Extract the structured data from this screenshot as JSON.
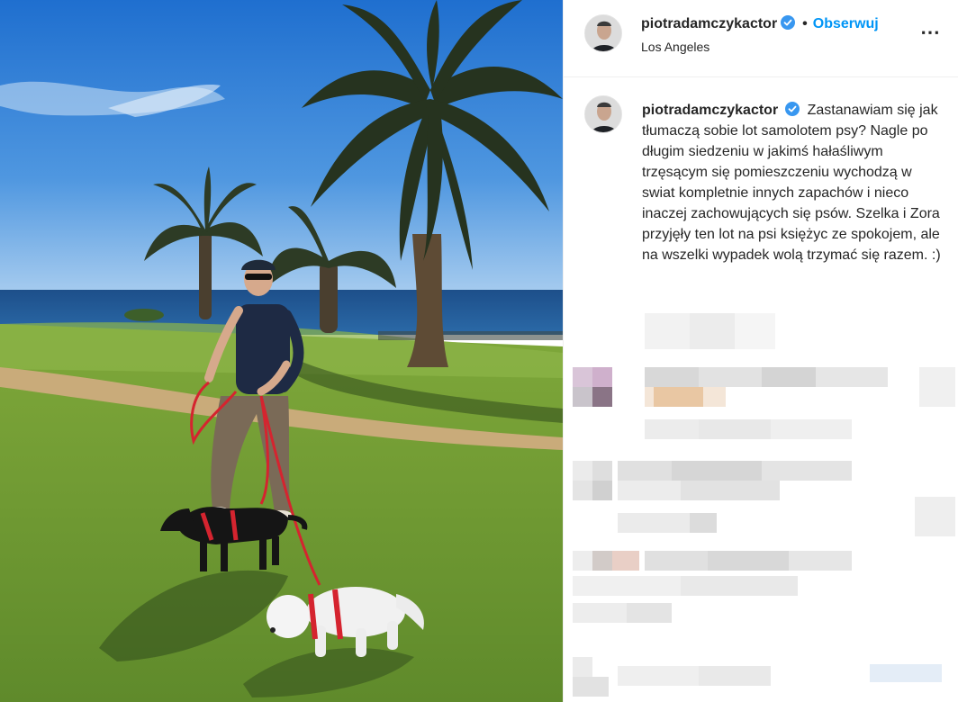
{
  "post": {
    "username": "piotradamczykactor",
    "verified": true,
    "dot": "•",
    "follow_label": "Obserwuj",
    "location": "Los Angeles",
    "more_icon": "⋯",
    "caption_text": "Zastanawiam się jak tłumaczą sobie lot samolotem psy? Nagle po długim siedzeniu w jakimś hałaśliwym trzęsącym się pomieszczeniu wychodzą w swiat kompletnie innych zapachów i nieco inaczej zachowujących się psów. Szelka i Zora przyjęły ten lot na psi księżyc ze spokojem, ale na wszelki wypadek wolą trzymać się razem. :)"
  },
  "icons": {
    "verified": "verified-badge-icon",
    "more": "more-options-icon"
  },
  "colors": {
    "accent": "#0095f6",
    "text": "#262626",
    "verified": "#3897f0"
  }
}
